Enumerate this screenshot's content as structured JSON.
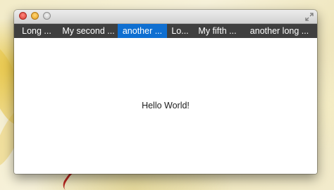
{
  "window": {
    "title": "",
    "controls": {
      "close": "close-icon",
      "minimize": "minimize-icon",
      "zoom": "zoom-icon",
      "fullscreen": "fullscreen-icon"
    }
  },
  "tabs": [
    {
      "label": "Long ...",
      "selected": false
    },
    {
      "label": "My second ...",
      "selected": false
    },
    {
      "label": "another ...",
      "selected": true
    },
    {
      "label": "Lo...",
      "selected": false
    },
    {
      "label": "My fifth ...",
      "selected": false
    },
    {
      "label": "another long ...",
      "selected": false
    }
  ],
  "content": {
    "message": "Hello World!"
  },
  "colors": {
    "tabbar_bg": "#3f3f3f",
    "tab_selected": "#0f6fd1",
    "tab_text": "#ffffff"
  }
}
